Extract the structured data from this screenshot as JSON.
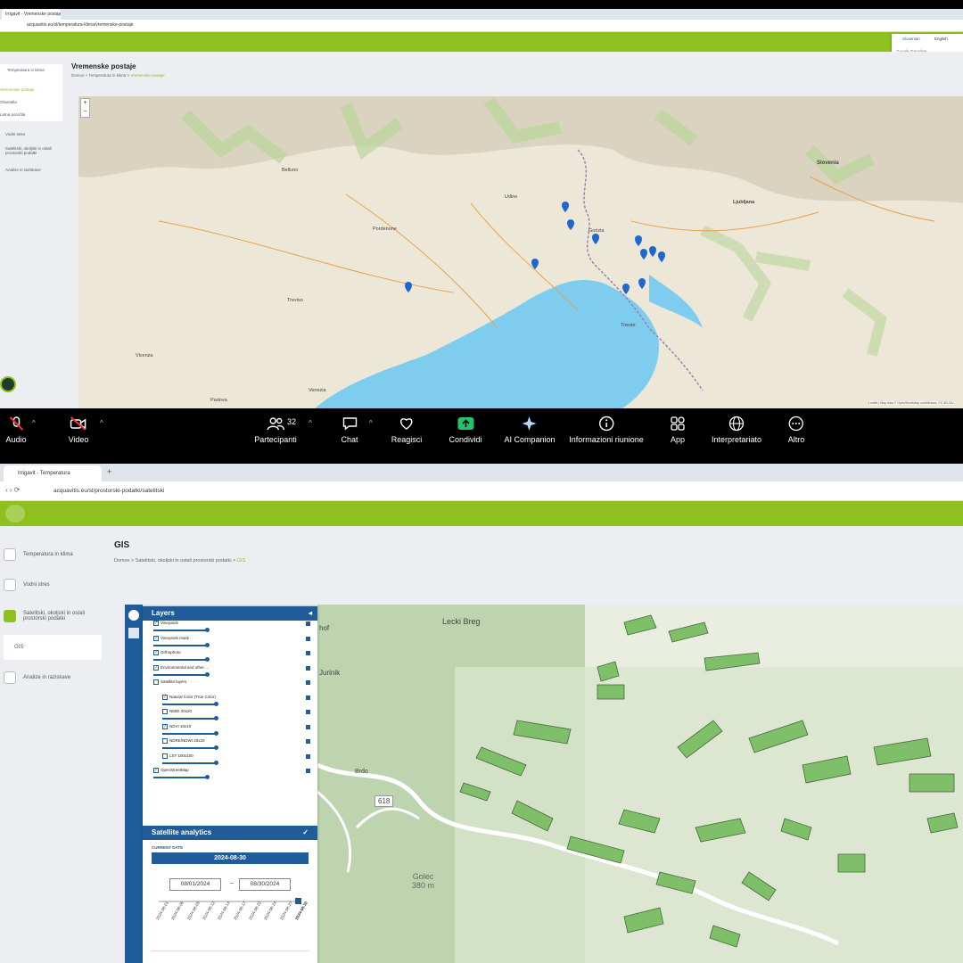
{
  "top": {
    "tab_title": "Irrigavit - Vremenske postaje",
    "url": "acquavitis.eu/sl/temperatura-klima/vremenske-postaje",
    "lang": {
      "items": [
        "Slovenian",
        "English"
      ],
      "note": "Google Translate"
    },
    "sidebar": {
      "items": [
        "Temperatura in klima",
        "Vremenske postaje",
        "Obvestila",
        "Letna poročila",
        "Vodni stres",
        "Satelitski, okoljski in ostali prostorski podatki",
        "Analize in raziskave"
      ]
    },
    "page_title": "Vremenske postaje",
    "breadcrumb": [
      "Domov",
      "Temperatura in klima",
      "Vremenske postaje"
    ],
    "map": {
      "labels": [
        "Slovenia",
        "Ljubljana",
        "Belluno",
        "Udine",
        "Gorizia",
        "Pordenone",
        "Treviso",
        "Venezia",
        "Trieste",
        "Vicenza",
        "Padova"
      ],
      "attribution": "Leaflet | Map data © OpenStreetMap contributors, CC-BY-SA",
      "zoom_in": "+",
      "zoom_out": "−"
    },
    "toolbar": {
      "audio": "Audio",
      "video": "Video",
      "participants": "Partecipanti",
      "participants_count": "32",
      "chat": "Chat",
      "react": "Reagisci",
      "share": "Condividi",
      "companion": "AI Companion",
      "info": "Informazioni riunione",
      "app": "App",
      "interp": "Interpretariato",
      "more": "Altro"
    }
  },
  "bottom": {
    "tab_title": "Irrigavit - Temperatura",
    "url": "acquavitis.eu/sl/prostorski-podatki/satelitski",
    "sidebar": {
      "items": [
        "Temperatura in klima",
        "Vodni stres",
        "Satelitski, okoljski in ostali prostorski podatki",
        "GIS",
        "Analize in raziskave"
      ]
    },
    "page_title": "GIS",
    "breadcrumb": [
      "Domov",
      "Satelitski, okoljski in ostali prostorski podatki",
      "GIS"
    ],
    "layers": {
      "title": "Layers",
      "items": [
        {
          "label": "Vineyards",
          "checked": true
        },
        {
          "label": "Vineyards mask",
          "checked": true
        },
        {
          "label": "Orthophoto",
          "checked": true
        },
        {
          "label": "Environmental and other ...",
          "checked": true
        },
        {
          "label": "Satellite layers",
          "checked": false
        },
        {
          "label": "Natural Color (True Color)",
          "checked": true
        },
        {
          "label": "NMDI 20x20",
          "checked": false
        },
        {
          "label": "NDVI 10x10",
          "checked": true
        },
        {
          "label": "NDRE/NDWI 20x20",
          "checked": false
        },
        {
          "label": "LST 100x100",
          "checked": false
        },
        {
          "label": "OpenStreetMap",
          "checked": true
        }
      ]
    },
    "analytics": {
      "title": "Satellite analytics",
      "current_date_label": "CURRENT DATE",
      "current_date": "2024-08-30",
      "from": "08/01/2024",
      "to": "08/30/2024",
      "dash": "–",
      "dates": [
        "2024-08-01",
        "2024-08-06",
        "2024-08-09",
        "2024-08-12",
        "2024-08-14",
        "2024-08-17",
        "2024-08-22",
        "2024-08-24",
        "2024-08-27",
        "2024-08-30"
      ]
    },
    "map": {
      "labels": [
        "Lecki Breg",
        "Golec\n380 m",
        "618",
        "Brdo",
        "hof",
        "Jurinik"
      ]
    }
  }
}
